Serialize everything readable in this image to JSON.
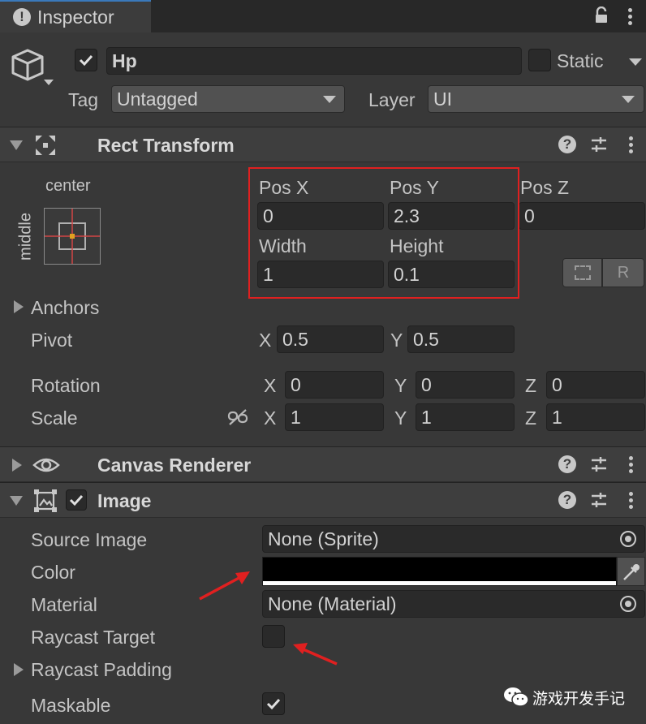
{
  "tab": {
    "title": "Inspector"
  },
  "object": {
    "name": "Hp",
    "static_label": "Static",
    "tag_label": "Tag",
    "tag_value": "Untagged",
    "layer_label": "Layer",
    "layer_value": "UI"
  },
  "rect_transform": {
    "title": "Rect Transform",
    "anchor_h": "center",
    "anchor_v": "middle",
    "pos_x_label": "Pos X",
    "pos_y_label": "Pos Y",
    "pos_z_label": "Pos Z",
    "pos_x": "0",
    "pos_y": "2.3",
    "pos_z": "0",
    "width_label": "Width",
    "height_label": "Height",
    "width": "1",
    "height": "0.1",
    "r_button": "R",
    "anchors_label": "Anchors",
    "pivot_label": "Pivot",
    "pivot_x_label": "X",
    "pivot_x": "0.5",
    "pivot_y_label": "Y",
    "pivot_y": "0.5",
    "rotation_label": "Rotation",
    "rot_x": "0",
    "rot_y": "0",
    "rot_z": "0",
    "scale_label": "Scale",
    "scale_x": "1",
    "scale_y": "1",
    "scale_z": "1",
    "x_label": "X",
    "y_label": "Y",
    "z_label": "Z"
  },
  "canvas_renderer": {
    "title": "Canvas Renderer"
  },
  "image": {
    "title": "Image",
    "source_image_label": "Source Image",
    "source_image_value": "None (Sprite)",
    "color_label": "Color",
    "color_value": "#000000",
    "material_label": "Material",
    "material_value": "None (Material)",
    "raycast_target_label": "Raycast Target",
    "raycast_padding_label": "Raycast Padding",
    "maskable_label": "Maskable"
  },
  "watermark": {
    "text": "游戏开发手记"
  },
  "colors": {
    "highlight_box": "#e02020",
    "arrow": "#e02020",
    "background": "#383838"
  }
}
